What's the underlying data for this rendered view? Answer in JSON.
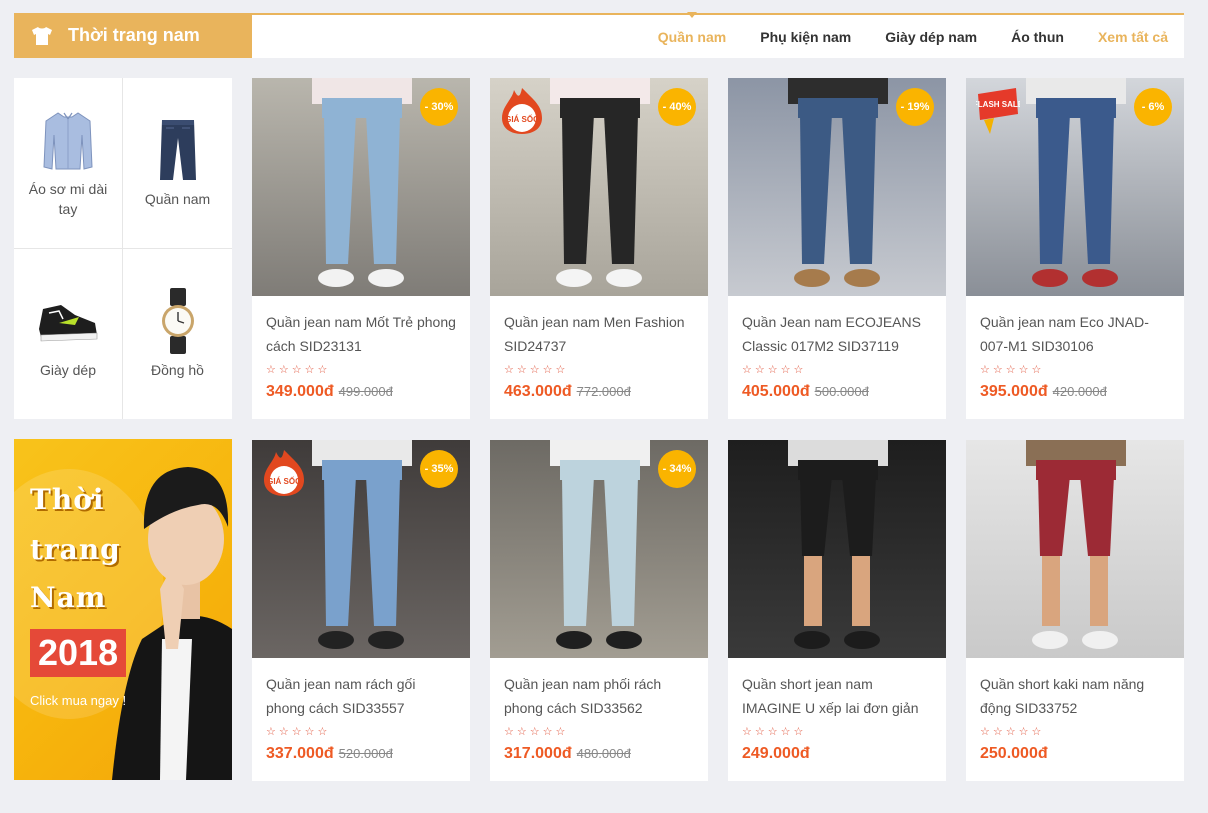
{
  "header": {
    "title": "Thời trang nam",
    "tabs": [
      "Quần nam",
      "Phụ kiện nam",
      "Giày dép nam",
      "Áo thun"
    ],
    "see_all": "Xem tất cả"
  },
  "subcategories": [
    {
      "label": "Áo sơ mi dài tay",
      "icon": "shirt-icon"
    },
    {
      "label": "Quần nam",
      "icon": "jeans-icon"
    },
    {
      "label": "Giày dép",
      "icon": "sneaker-icon"
    },
    {
      "label": "Đồng hồ",
      "icon": "watch-icon"
    }
  ],
  "banner": {
    "line1": "Thời",
    "line2": "trang",
    "line3": "Nam",
    "year": "2018",
    "cta": "Click mua ngay !"
  },
  "colors": {
    "accent": "#e9b45c",
    "price": "#ee5a24",
    "discount_badge": "#fab400"
  },
  "products": [
    {
      "name": "Quần jean nam Mốt Trẻ phong cách SID23131",
      "price": "349.000đ",
      "old_price": "499.000đ",
      "discount": "- 30%",
      "sticker": ""
    },
    {
      "name": "Quần jean nam Men Fashion SID24737",
      "price": "463.000đ",
      "old_price": "772.000đ",
      "discount": "- 40%",
      "sticker": "GIÁ SỐC"
    },
    {
      "name": "Quần Jean nam ECOJEANS Classic 017M2 SID37119",
      "price": "405.000đ",
      "old_price": "500.000đ",
      "discount": "- 19%",
      "sticker": ""
    },
    {
      "name": "Quần jean nam Eco JNAD-007-M1 SID30106",
      "price": "395.000đ",
      "old_price": "420.000đ",
      "discount": "- 6%",
      "sticker": "FLASH SALE"
    },
    {
      "name": "Quần jean nam rách gối phong cách SID33557",
      "price": "337.000đ",
      "old_price": "520.000đ",
      "discount": "- 35%",
      "sticker": "GIÁ SỐC"
    },
    {
      "name": "Quần jean nam phối rách phong cách SID33562",
      "price": "317.000đ",
      "old_price": "480.000đ",
      "discount": "- 34%",
      "sticker": ""
    },
    {
      "name": "Quần short jean nam IMAGINE U xếp lai đơn giản",
      "price": "249.000đ",
      "old_price": "",
      "discount": "",
      "sticker": ""
    },
    {
      "name": "Quần short kaki nam năng động SID33752",
      "price": "250.000đ",
      "old_price": "",
      "discount": "",
      "sticker": ""
    }
  ]
}
